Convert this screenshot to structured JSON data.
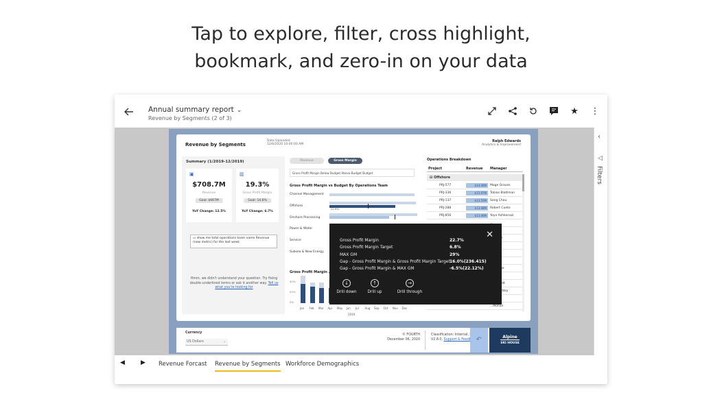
{
  "headline": {
    "line1": "Tap to explore, filter, cross highlight,",
    "line2": "bookmark, and zero-in on your data"
  },
  "appbar": {
    "title": "Annual summary report",
    "subtitle": "Revenue by Segments (2 of 3)",
    "icons": [
      "back-arrow-icon",
      "expand-icon",
      "share-icon",
      "reset-icon",
      "comment-icon",
      "favorite-star-icon",
      "more-icon"
    ]
  },
  "filters_pane": {
    "label": "Filters"
  },
  "report": {
    "title": "Revenue by Segments",
    "date_uploaded_label": "Date Uploaded",
    "date_uploaded_value": "12/6/2020 10:00:00 AM",
    "user_name": "Ralph Edwards",
    "user_role": "Analytics & Improvement",
    "summary": {
      "title": "Summary (1/2019-12/2019)",
      "kpis": [
        {
          "value": "$708.7M",
          "label": "Revenue",
          "goal": "Goal: $667M",
          "yoy": "YoY Change: 12.5%"
        },
        {
          "value": "19.3%",
          "label": "Gross Profit Margin",
          "goal": "Goal: 14.6%",
          "yoy": "YoY Change: 6.7%"
        }
      ],
      "qa_text": "show me total operations team name Revenue (new metric) for the last week",
      "hmm_text": "Hmm, we didn't understand your question. Try fixing double-underlined terms or ask it another way.",
      "hmm_link": "Tell us what you're looking for"
    },
    "toggles": {
      "left": "Revenue",
      "right": "Gross Margin"
    },
    "legend_text": "Gross Profit Margin  Below Budget  Above Budget  Budget",
    "bullet_title": "Gross Profit Margin vs Budget By Operations Team",
    "bullet_rows": [
      {
        "label": "Channel Management",
        "value": ""
      },
      {
        "label": "Offshore",
        "value": ""
      },
      {
        "label": "Onshore Processing",
        "value": ""
      },
      {
        "label": "Power & Water",
        "value": ""
      },
      {
        "label": "Service",
        "value": ""
      },
      {
        "label": "Subsea & New Energy",
        "value": ""
      }
    ],
    "column_chart": {
      "title": "Gross Profit Margin ...",
      "months": [
        "Jan",
        "Feb",
        "Mar",
        "Apr",
        "May",
        "Jun",
        "Jul",
        "Aug",
        "Sep",
        "Oct",
        "Nov",
        "Dec"
      ],
      "year": "2019",
      "y_ticks": [
        "40%",
        "20%",
        "0%"
      ]
    },
    "operations": {
      "title": "Operations Breakdown",
      "headers": [
        "Project",
        "Revenue",
        "Manager"
      ],
      "group": "Offshore",
      "rows": [
        {
          "project": "PRJ-577",
          "revenue": "$14.06M",
          "manager": "Mage Graves"
        },
        {
          "project": "PRJ-336",
          "revenue": "$13.97M",
          "manager": "Tobias Blattman"
        },
        {
          "project": "PRJ-137",
          "revenue": "$13.55M",
          "manager": "Sang Chou"
        },
        {
          "project": "PRJ-288",
          "revenue": "$13.08M",
          "manager": "Robert Cueto"
        },
        {
          "project": "PRJ-856",
          "revenue": "$13.06M",
          "manager": "Yoyo Ashkenazi"
        },
        {
          "project": "",
          "revenue": "",
          "manager": "..."
        },
        {
          "project": "",
          "revenue": "",
          "manager": "...eese"
        },
        {
          "project": "",
          "revenue": "",
          "manager": "...orsyth"
        },
        {
          "project": "",
          "revenue": "",
          "manager": "...les"
        },
        {
          "project": "",
          "revenue": "",
          "manager": "...rose"
        },
        {
          "project": "",
          "revenue": "",
          "manager": "...ryle"
        },
        {
          "project": "",
          "revenue": "",
          "manager": "...Greene"
        },
        {
          "project": "",
          "revenue": "",
          "manager": "...esele"
        },
        {
          "project": "",
          "revenue": "",
          "manager": "...Hinmelt"
        },
        {
          "project": "",
          "revenue": "",
          "manager": "...e Brodsky"
        },
        {
          "project": "",
          "revenue": "",
          "manager": "...isher"
        },
        {
          "project": "",
          "revenue": "",
          "manager": "...Mohan"
        }
      ]
    },
    "footer": {
      "currency_label": "Currency",
      "currency_value": "US Dollars",
      "company": "© FOURTH",
      "date": "December 06, 2020",
      "classification": "Classification: Internal, Restricted",
      "version": "V2.8.0,",
      "support_link": "Support & Feedback",
      "logo_top": "Alpine",
      "logo_bottom": "SKI HOUSE"
    }
  },
  "tooltip": {
    "rows": [
      {
        "label": "Gross Profit Margin",
        "value": "22.7%"
      },
      {
        "label": "Gross Profit Margin Target",
        "value": "6.8%"
      },
      {
        "label": "MAX GM",
        "value": "29%"
      },
      {
        "label": "Gap - Gross Profit Margin & Gross Profit Margin Target",
        "value": "16.0%(236.415)"
      },
      {
        "label": "Gap - Gross Profit Margin & MAX GM",
        "value": "-6.5%(22.12%)"
      }
    ],
    "actions": [
      "Drill down",
      "Drill up",
      "Drill through"
    ]
  },
  "page_tabs": {
    "tabs": [
      "Revenue Forcast",
      "Revenue by Segments",
      "Workforce Demographics"
    ],
    "active_index": 1
  }
}
